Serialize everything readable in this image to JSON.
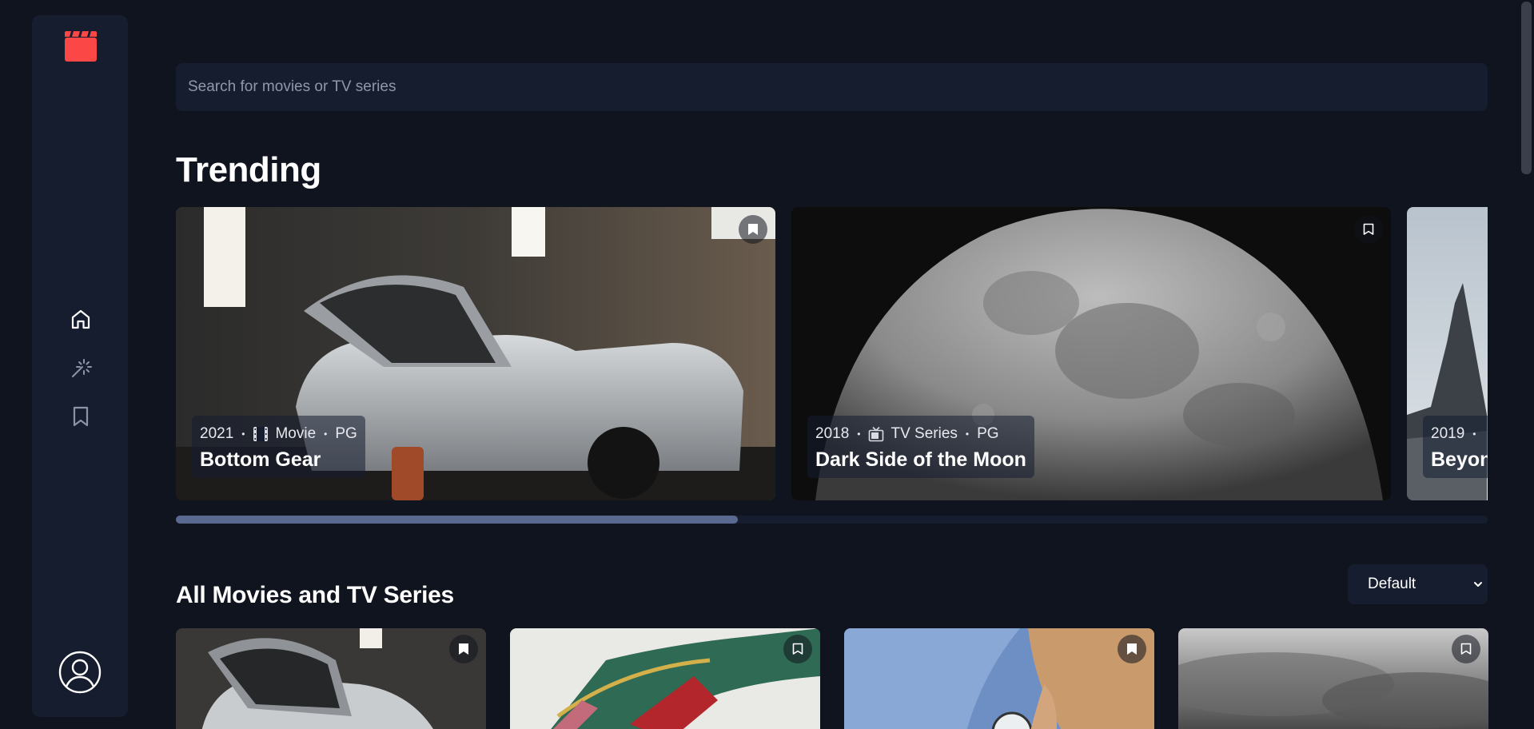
{
  "app": {
    "logo": "clapperboard-icon",
    "accent_color": "#fc4747",
    "background": "#10141e",
    "surface": "#161d2f"
  },
  "sidebar": {
    "items": [
      {
        "id": "home",
        "icon": "home-icon",
        "active": true
      },
      {
        "id": "discover",
        "icon": "magic-wand-icon",
        "active": false
      },
      {
        "id": "bookmarks",
        "icon": "bookmark-icon",
        "active": false
      }
    ],
    "avatar": "user-avatar-icon"
  },
  "search": {
    "placeholder": "Search for movies or TV series",
    "value": ""
  },
  "trending": {
    "heading": "Trending",
    "items": [
      {
        "year": "2021",
        "sep": "•",
        "category": "Movie",
        "category_icon": "film-icon",
        "rating": "PG",
        "title": "Bottom Gear",
        "bookmarked": true
      },
      {
        "year": "2018",
        "sep": "•",
        "category": "TV Series",
        "category_icon": "tv-icon",
        "rating": "PG",
        "title": "Dark Side of the Moon",
        "bookmarked": false
      },
      {
        "year": "2019",
        "sep": "•",
        "title": "Beyond Earth"
      }
    ],
    "scroll_progress_percent": 43
  },
  "all": {
    "heading": "All Movies and TV Series",
    "sort": {
      "selected": "Default"
    },
    "items": [
      {
        "bookmarked": true
      },
      {
        "bookmarked": false
      },
      {
        "bookmarked": true
      },
      {
        "bookmarked": false
      }
    ]
  }
}
